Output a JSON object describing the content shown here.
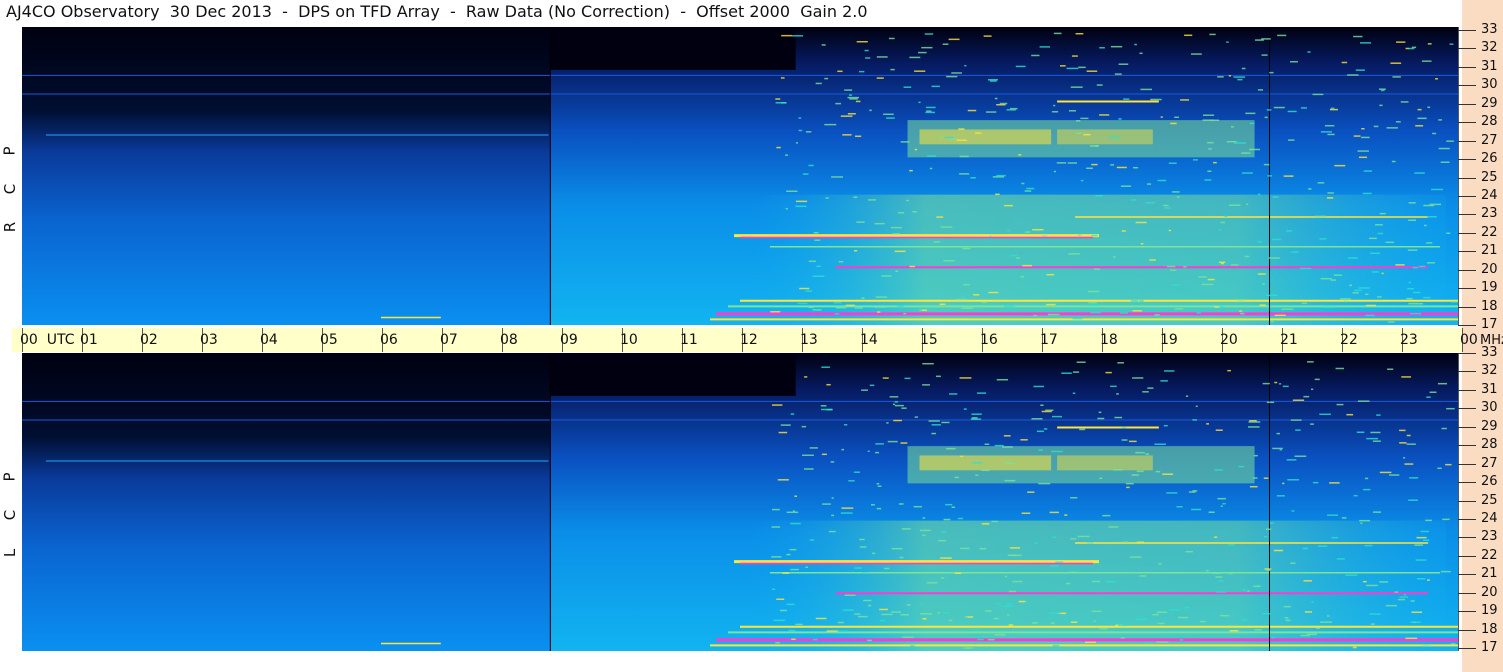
{
  "window": {
    "title": "AJ4CO Observatory  30 Dec 2013  -  DPS on TFD Array  -  Raw Data (No Correction)  -  Offset 2000  Gain 2.0"
  },
  "panels": {
    "top_label": [
      "R",
      "C",
      "P"
    ],
    "bottom_label": [
      "L",
      "C",
      "P"
    ]
  },
  "time_axis": {
    "ticks": [
      "00  UTC",
      "01",
      "02",
      "03",
      "04",
      "05",
      "06",
      "07",
      "08",
      "09",
      "10",
      "11",
      "12",
      "13",
      "14",
      "15",
      "16",
      "17",
      "18",
      "19",
      "20",
      "21",
      "22",
      "23",
      "00"
    ],
    "unit": "MHz"
  },
  "freq_axis": {
    "ticks": [
      "33",
      "32",
      "31",
      "30",
      "29",
      "28",
      "27",
      "26",
      "25",
      "24",
      "23",
      "22",
      "21",
      "20",
      "19",
      "18",
      "17"
    ]
  },
  "chart_data": {
    "type": "heatmap",
    "title": "AJ4CO Observatory  30 Dec 2013  -  DPS on TFD Array  -  Raw Data (No Correction)  -  Offset 2000  Gain 2.0",
    "x_range_hours_utc": [
      0,
      24
    ],
    "y_range_mhz": [
      17,
      33
    ],
    "panels": [
      "R C P",
      "L C P"
    ],
    "colors": {
      "background": "#00103a",
      "low": "#0a3ea8",
      "mid": "#0aa8e8",
      "high": "#7be39a",
      "hot": "#ffe53a",
      "peak": "#ff3ad0"
    }
  }
}
